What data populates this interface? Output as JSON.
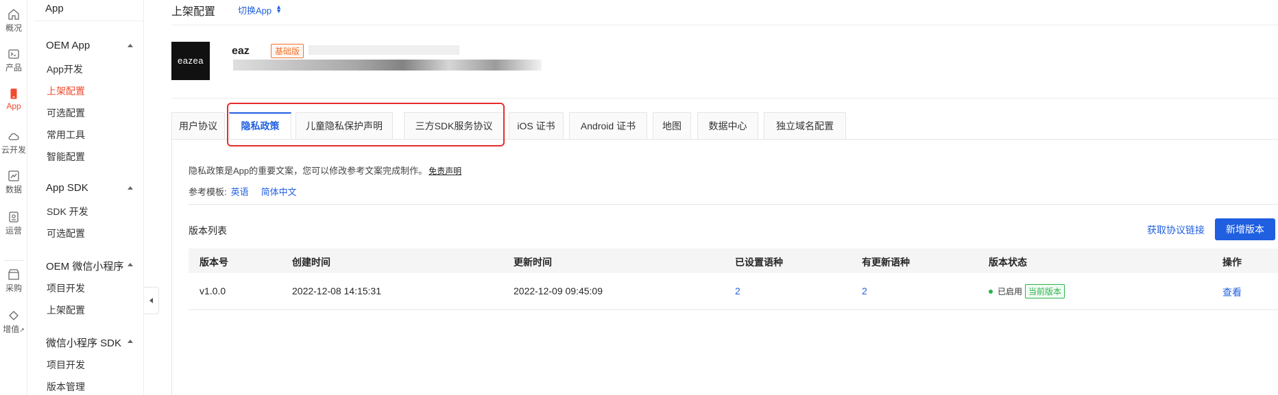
{
  "rail": [
    {
      "label": "概况",
      "icon": "home-icon"
    },
    {
      "label": "产品",
      "icon": "terminal-icon"
    },
    {
      "label": "App",
      "icon": "phone-icon"
    },
    {
      "label": "云开发",
      "icon": "cloud-icon"
    },
    {
      "label": "数据",
      "icon": "chart-icon"
    },
    {
      "label": "运营",
      "icon": "badge-icon"
    },
    {
      "label": "采购",
      "icon": "store-icon"
    },
    {
      "label": "增值",
      "icon": "diamond-icon"
    }
  ],
  "sidebar": {
    "top": "App",
    "groups": [
      {
        "title": "OEM App",
        "items": [
          "App开发",
          "上架配置",
          "可选配置",
          "常用工具",
          "智能配置"
        ]
      },
      {
        "title": "App SDK",
        "items": [
          "SDK 开发",
          "可选配置"
        ]
      },
      {
        "title": "OEM 微信小程序",
        "items": [
          "项目开发",
          "上架配置"
        ]
      },
      {
        "title": "微信小程序 SDK",
        "items": [
          "项目开发",
          "版本管理"
        ]
      }
    ]
  },
  "header": {
    "title": "上架配置",
    "switch": "切换App"
  },
  "app": {
    "logo": "eazea",
    "name": "eaz",
    "edition": "基础版"
  },
  "tabs": [
    "用户协议",
    "隐私政策",
    "儿童隐私保护声明",
    "三方SDK服务协议",
    "iOS 证书",
    "Android 证书",
    "地图",
    "数据中心",
    "独立域名配置"
  ],
  "active_tab": "隐私政策",
  "description": {
    "text": "隐私政策是App的重要文案，您可以修改参考文案完成制作。",
    "disclaimer": "免责声明"
  },
  "reference": {
    "label": "参考模板:",
    "options": [
      "英语",
      "简体中文"
    ]
  },
  "versions": {
    "title": "版本列表",
    "get_link": "获取协议链接",
    "add_button": "新增版本",
    "columns": [
      "版本号",
      "创建时间",
      "更新时间",
      "已设置语种",
      "有更新语种",
      "版本状态",
      "操作"
    ],
    "rows": [
      {
        "version": "v1.0.0",
        "created": "2022-12-08 14:15:31",
        "updated": "2022-12-09 09:45:09",
        "set_langs": "2",
        "updated_langs": "2",
        "status": "已启用",
        "tag": "当前版本",
        "action": "查看"
      }
    ]
  },
  "colors": {
    "accent": "#1f5fe0",
    "active_nav": "#f04b2e",
    "highlight": "#e82b2b",
    "success": "#2bb24c"
  }
}
